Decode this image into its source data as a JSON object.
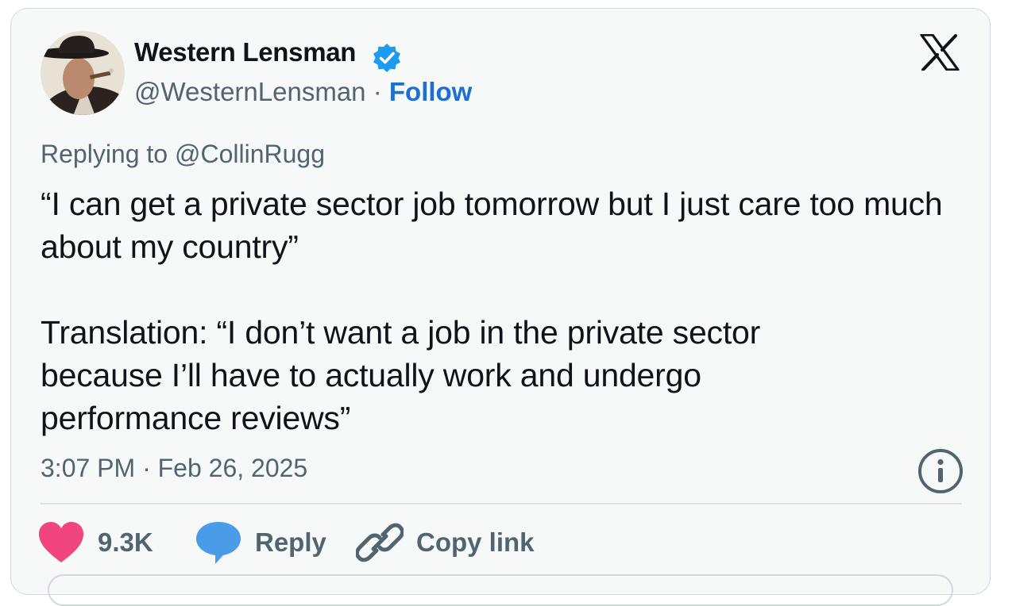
{
  "author": {
    "display_name": "Western Lensman",
    "handle": "@WesternLensman",
    "separator": "·",
    "follow_label": "Follow",
    "verified": true
  },
  "tweet": {
    "replying_to": "Replying to @CollinRugg",
    "paragraphs": [
      "“I can get a private sector job tomorrow but I just care too much about my country”",
      "Translation: “I don’t want a job in the private sector because I’ll have to actually work and undergo performance reviews”"
    ],
    "timestamp": "3:07 PM · Feb 26, 2025"
  },
  "actions": {
    "like_count": "9.3K",
    "reply_label": "Reply",
    "copy_label": "Copy link"
  },
  "colors": {
    "card_bg": "#f7f9f9",
    "text": "#0f1419",
    "secondary": "#536471",
    "accent": "#1d9bf0",
    "like": "#f91880"
  },
  "icons": [
    "verified-badge-icon",
    "x-logo-icon",
    "info-icon",
    "heart-icon",
    "reply-bubble-icon",
    "link-icon"
  ]
}
